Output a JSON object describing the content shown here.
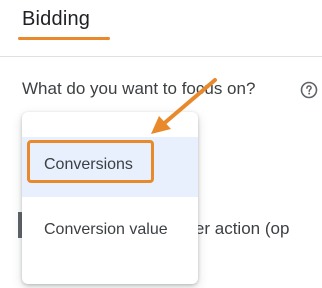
{
  "section": {
    "title": "Bidding"
  },
  "question": {
    "text": "What do you want to focus on?"
  },
  "icons": {
    "help": "help-circle-icon",
    "annotation": "arrow-pointer-icon"
  },
  "dropdown": {
    "options": [
      {
        "label": "Conversions",
        "selected": true
      },
      {
        "label": "Conversion value",
        "selected": false
      }
    ]
  },
  "background": {
    "partial_text": "t per action (op"
  },
  "colors": {
    "accent_annotation": "#e8892b",
    "selected_bg": "#e8f0fe",
    "text": "#3c4043"
  }
}
